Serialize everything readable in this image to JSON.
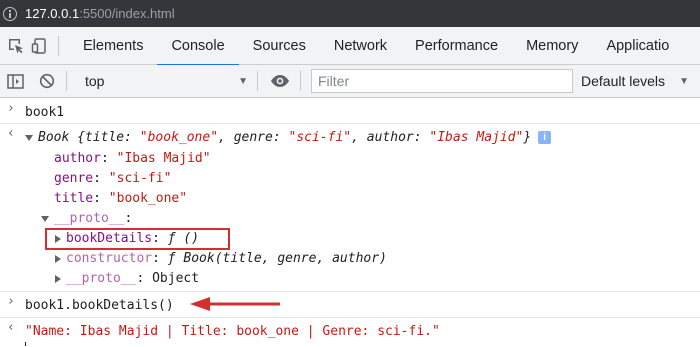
{
  "browser": {
    "url_host": "127.0.0.1",
    "url_path": ":5500/index.html"
  },
  "devtools": {
    "tabs": [
      {
        "label": "Elements"
      },
      {
        "label": "Console"
      },
      {
        "label": "Sources"
      },
      {
        "label": "Network"
      },
      {
        "label": "Performance"
      },
      {
        "label": "Memory"
      },
      {
        "label": "Applicatio"
      }
    ],
    "active_tab": "Console",
    "accent_color": "#1a73e8"
  },
  "console_toolbar": {
    "context": "top",
    "filter_placeholder": "Filter",
    "levels": "Default levels"
  },
  "console": {
    "cmd1": "book1",
    "obj_class": "Book",
    "obj_open": " {title: ",
    "obj_title": "\"book_one\"",
    "obj_genre_key": ", genre: ",
    "obj_genre": "\"sci-fi\"",
    "obj_author_key": ", author: ",
    "obj_author": "\"Ibas Majid\"",
    "obj_close": "}",
    "info_badge": "i",
    "author_key": "author",
    "author_val": "\"Ibas Majid\"",
    "genre_key": "genre",
    "genre_val": "\"sci-fi\"",
    "title_key": "title",
    "title_val": "\"book_one\"",
    "proto_key": "__proto__",
    "bookDetails_key": "bookDetails",
    "bookDetails_val": "ƒ ()",
    "constructor_key": "constructor",
    "constructor_val": "ƒ Book(title, genre, author)",
    "proto2_key": "__proto__",
    "proto2_val": "Object",
    "cmd2": "book1.bookDetails()",
    "result": "\"Name: Ibas Majid | Title: book_one | Genre: sci-fi.\"",
    "highlight_color": "#d32f2f"
  }
}
